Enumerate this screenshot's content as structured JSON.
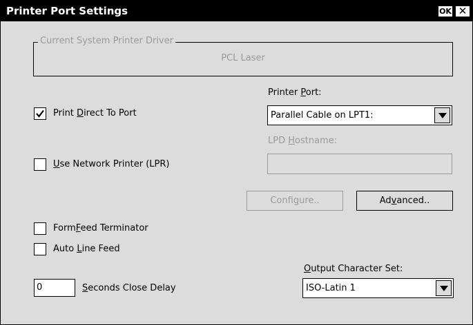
{
  "window": {
    "title": "Printer Port Settings",
    "ok_label": "OK",
    "close_label": "✕"
  },
  "driver_group": {
    "legend": "Current System Printer Driver",
    "value": "PCL Laser"
  },
  "print_direct": {
    "label_pre": "Print ",
    "label_accel": "D",
    "label_post": "irect To Port",
    "checked": true
  },
  "printer_port": {
    "label_pre": "Printer ",
    "label_accel": "P",
    "label_post": "ort:",
    "selected": "Parallel Cable on LPT1:"
  },
  "use_network": {
    "label_pre": "",
    "label_accel": "U",
    "label_post": "se Network Printer (LPR)",
    "checked": false
  },
  "lpd_hostname": {
    "label_pre": "LPD ",
    "label_accel": "H",
    "label_post": "ostname:",
    "value": ""
  },
  "configure_button": {
    "label_pre": "Confi",
    "label_accel": "g",
    "label_post": "ure.."
  },
  "advanced_button": {
    "label_pre": "Ad",
    "label_accel": "v",
    "label_post": "anced.."
  },
  "formfeed": {
    "label_pre": "Form",
    "label_accel": "F",
    "label_post": "eed Terminator",
    "checked": false
  },
  "auto_line_feed": {
    "label_pre": "Auto ",
    "label_accel": "L",
    "label_post": "ine Feed",
    "checked": false
  },
  "close_delay": {
    "value": "0",
    "label_pre": "",
    "label_accel": "S",
    "label_post": "econds Close Delay"
  },
  "output_charset": {
    "label_pre": "",
    "label_accel": "O",
    "label_post": "utput Character Set:",
    "selected": "ISO-Latin 1"
  }
}
